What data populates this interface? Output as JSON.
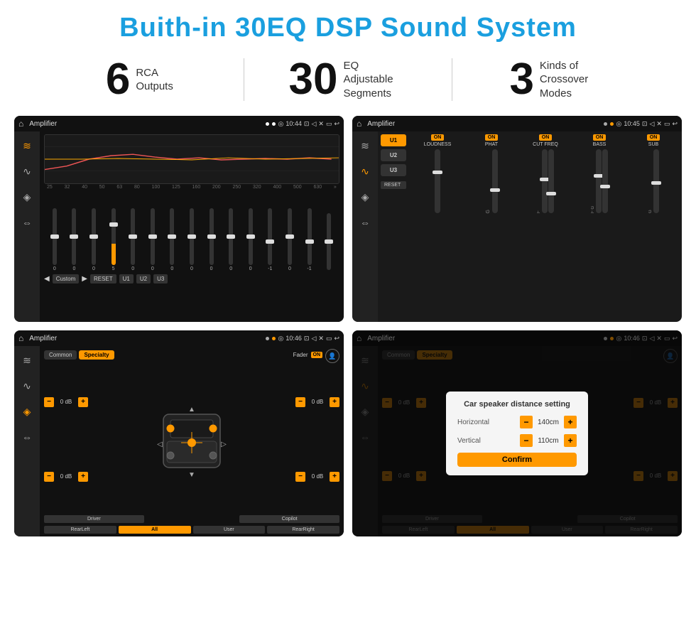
{
  "page": {
    "title": "Buith-in 30EQ DSP Sound System",
    "stats": [
      {
        "number": "6",
        "label": "RCA\nOutputs"
      },
      {
        "number": "30",
        "label": "EQ Adjustable\nSegments"
      },
      {
        "number": "3",
        "label": "Kinds of\nCrossover Modes"
      }
    ]
  },
  "screen1": {
    "status": "Amplifier",
    "time": "10:44",
    "eq_bands": [
      "25",
      "32",
      "40",
      "50",
      "63",
      "80",
      "100",
      "125",
      "160",
      "200",
      "250",
      "320",
      "400",
      "500",
      "630"
    ],
    "eq_values": [
      "0",
      "0",
      "0",
      "5",
      "0",
      "0",
      "0",
      "0",
      "0",
      "0",
      "0",
      "-1",
      "0",
      "-1",
      ""
    ],
    "buttons": [
      "Custom",
      "RESET",
      "U1",
      "U2",
      "U3"
    ]
  },
  "screen2": {
    "status": "Amplifier",
    "time": "10:45",
    "u_buttons": [
      "U1",
      "U2",
      "U3"
    ],
    "cols": [
      "LOUDNESS",
      "PHAT",
      "CUT FREQ",
      "BASS",
      "SUB"
    ],
    "on_badges": [
      "ON",
      "ON",
      "ON",
      "ON",
      "ON"
    ],
    "reset_label": "RESET"
  },
  "screen3": {
    "status": "Amplifier",
    "time": "10:46",
    "tabs": [
      "Common",
      "Specialty"
    ],
    "active_tab": "Specialty",
    "fader_label": "Fader",
    "fader_on": "ON",
    "volumes": [
      "0 dB",
      "0 dB",
      "0 dB",
      "0 dB"
    ],
    "bottom_btns": [
      "Driver",
      "",
      "Copilot",
      "RearLeft",
      "All",
      "User",
      "RearRight"
    ]
  },
  "screen4": {
    "status": "Amplifier",
    "time": "10:46",
    "tabs": [
      "Common",
      "Specialty"
    ],
    "dialog": {
      "title": "Car speaker distance setting",
      "rows": [
        {
          "label": "Horizontal",
          "value": "140cm"
        },
        {
          "label": "Vertical",
          "value": "110cm"
        }
      ],
      "confirm_label": "Confirm"
    },
    "volumes_right": [
      "0 dB",
      "0 dB"
    ],
    "bottom_btns": [
      "Driver",
      "Copilot",
      "RearLeft",
      "User",
      "RearRight"
    ]
  },
  "icons": {
    "home": "⌂",
    "back": "↩",
    "location": "◎",
    "camera": "📷",
    "volume": "🔊",
    "wifi": "⊠",
    "battery": "▭",
    "eq": "≋",
    "wave": "∿",
    "speaker": "◈",
    "expand": "⇔",
    "chevron_right": "»",
    "chevron_left": "«",
    "person": "👤",
    "play": "▶",
    "prev": "◀",
    "next": "▶"
  }
}
